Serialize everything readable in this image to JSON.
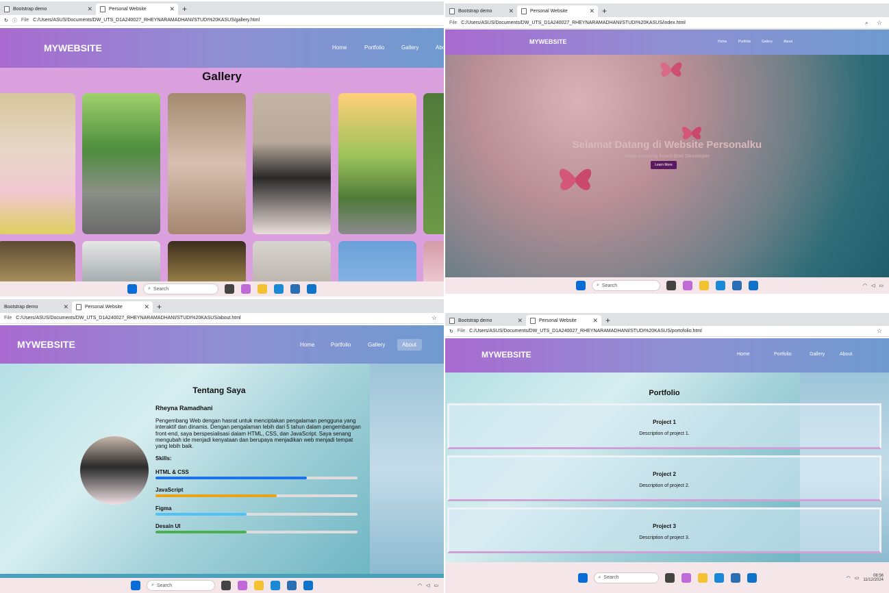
{
  "browser": {
    "tab_bootstrap": "Bootstrap demo",
    "tab_personal": "Personal Website",
    "file_label": "File"
  },
  "q1": {
    "url": "C:/Users/ASUS/Documents/DW_UTS_D1A240027_RHEYNARAMADHANI/STUDI%20KASUS/gallery.html",
    "brand": "MYWEBSITE",
    "nav": [
      "Home",
      "Portfolio",
      "Gallery",
      "Abo"
    ],
    "title": "Gallery"
  },
  "q2": {
    "url": "C:/Users/ASUS/Documents/DW_UTS_D1A240027_RHEYNARAMADHANI/STUDI%20KASUS/index.html",
    "brand": "MYWEBSITE",
    "nav": [
      "Home",
      "Portfolio",
      "Gallery",
      "About"
    ],
    "hero_title": "Selamat Datang di Website Personalku",
    "hero_sub": "Saya seorang Front-End Developer",
    "hero_button": "Learn More"
  },
  "q3": {
    "url": "C:/Users/ASUS/Documents/DW_UTS_D1A240027_RHEYNARAMADHANI/STUDI%20KASUS/about.html",
    "brand": "MYWEBSITE",
    "nav": [
      "Home",
      "Portfolio",
      "Gallery",
      "About"
    ],
    "title": "Tentang Saya",
    "name": "Rheyna Ramadhani",
    "bio": "Pengembang Web dengan hasrat untuk menciptakan pengalaman pengguna yang interaktif dan dinamis. Dengan pengalaman lebih dari 5 tahun dalam pengembangan front-end, saya berspesialisasi dalam HTML, CSS, dan JavaScript. Saya senang mengubah ide menjadi kenyataan dan berupaya menjadikan web menjadi tempat yang lebih baik.",
    "skills_heading": "Skills:",
    "skills": [
      {
        "name": "HTML & CSS",
        "level": 0.75,
        "color": "#1a73e8"
      },
      {
        "name": "JavaScript",
        "level": 0.6,
        "color": "#e8a317"
      },
      {
        "name": "Figma",
        "level": 0.45,
        "color": "#4fc3f7"
      },
      {
        "name": "Desain UI",
        "level": 0.45,
        "color": "#4caf50"
      }
    ]
  },
  "q4": {
    "url": "C:/Users/ASUS/Documents/DW_UTS_D1A240027_RHEYNARAMADHANI/STUDI%20KASUS/portofolio.html",
    "brand": "MYWEBSITE",
    "nav": [
      "Home",
      "Portfolio",
      "Gallery",
      "About"
    ],
    "title": "Portfolio",
    "projects": [
      {
        "title": "Project 1",
        "desc": "Description of project 1."
      },
      {
        "title": "Project 2",
        "desc": "Description of project 2."
      },
      {
        "title": "Project 3",
        "desc": "Description of project 3."
      }
    ]
  },
  "taskbar": {
    "search": "Search",
    "time": "08:56",
    "date": "11/12/2024"
  }
}
